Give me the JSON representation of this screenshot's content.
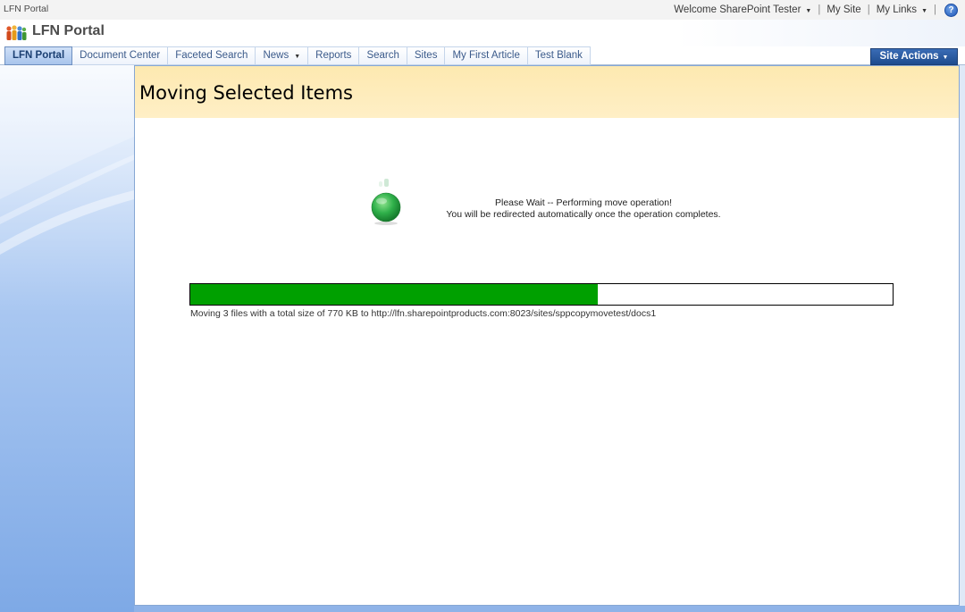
{
  "global_bar": {
    "site_name": "LFN Portal",
    "welcome_text": "Welcome SharePoint Tester",
    "my_site": "My Site",
    "my_links": "My Links",
    "help_icon": "help-icon"
  },
  "title_area": {
    "site_title": "LFN Portal",
    "logo_icon": "people-logo-icon"
  },
  "nav": {
    "tabs": [
      {
        "label": "LFN Portal",
        "selected": true
      },
      {
        "label": "Document Center"
      },
      {
        "label": "Faceted Search"
      },
      {
        "label": "News",
        "has_dropdown": true
      },
      {
        "label": "Reports"
      },
      {
        "label": "Search"
      },
      {
        "label": "Sites"
      },
      {
        "label": "My First Article"
      },
      {
        "label": "Test Blank"
      }
    ],
    "site_actions": "Site Actions"
  },
  "page": {
    "title": "Moving Selected Items",
    "wait_line1": "Please Wait -- Performing move operation!",
    "wait_line2": "You will be redirected automatically once the operation completes.",
    "progress_fraction": 0.58,
    "progress_caption": "Moving 3 files with a total size of 770 KB to http://lfn.sharepointproducts.com:8023/sites/sppcopymovetest/docs1"
  },
  "colors": {
    "progress_fill": "#00a000",
    "header_band": "#fde9b0",
    "site_actions_bg": "#2a5ba3",
    "selected_tab": "#b7cff1"
  }
}
